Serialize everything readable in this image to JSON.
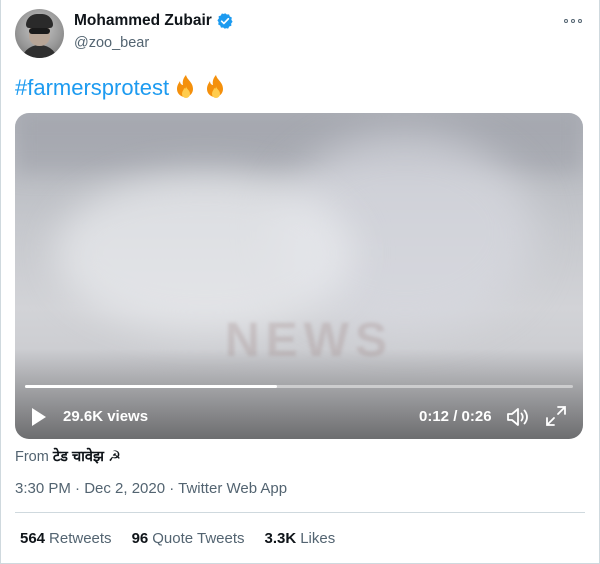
{
  "author": {
    "display_name": "Mohammed Zubair",
    "handle": "@zoo_bear",
    "verified": true
  },
  "tweet": {
    "hashtag": "#farmersprotest",
    "emoji": [
      "fire-icon",
      "fire-icon"
    ]
  },
  "video": {
    "views": "29.6K views",
    "time": "0:12 / 0:26",
    "progress": 0.46,
    "watermark": "NEWS"
  },
  "source": {
    "prefix": "From",
    "name": "टेड चावेझ ☭"
  },
  "meta": {
    "timestamp": "3:30 PM · Dec 2, 2020 · Twitter Web App"
  },
  "stats": {
    "retweets_count": "564",
    "retweets_label": "Retweets",
    "quotes_count": "96",
    "quotes_label": "Quote Tweets",
    "likes_count": "3.3K",
    "likes_label": "Likes"
  },
  "colors": {
    "accent": "#1d9bf0",
    "muted": "#536471",
    "text": "#0f1419"
  }
}
